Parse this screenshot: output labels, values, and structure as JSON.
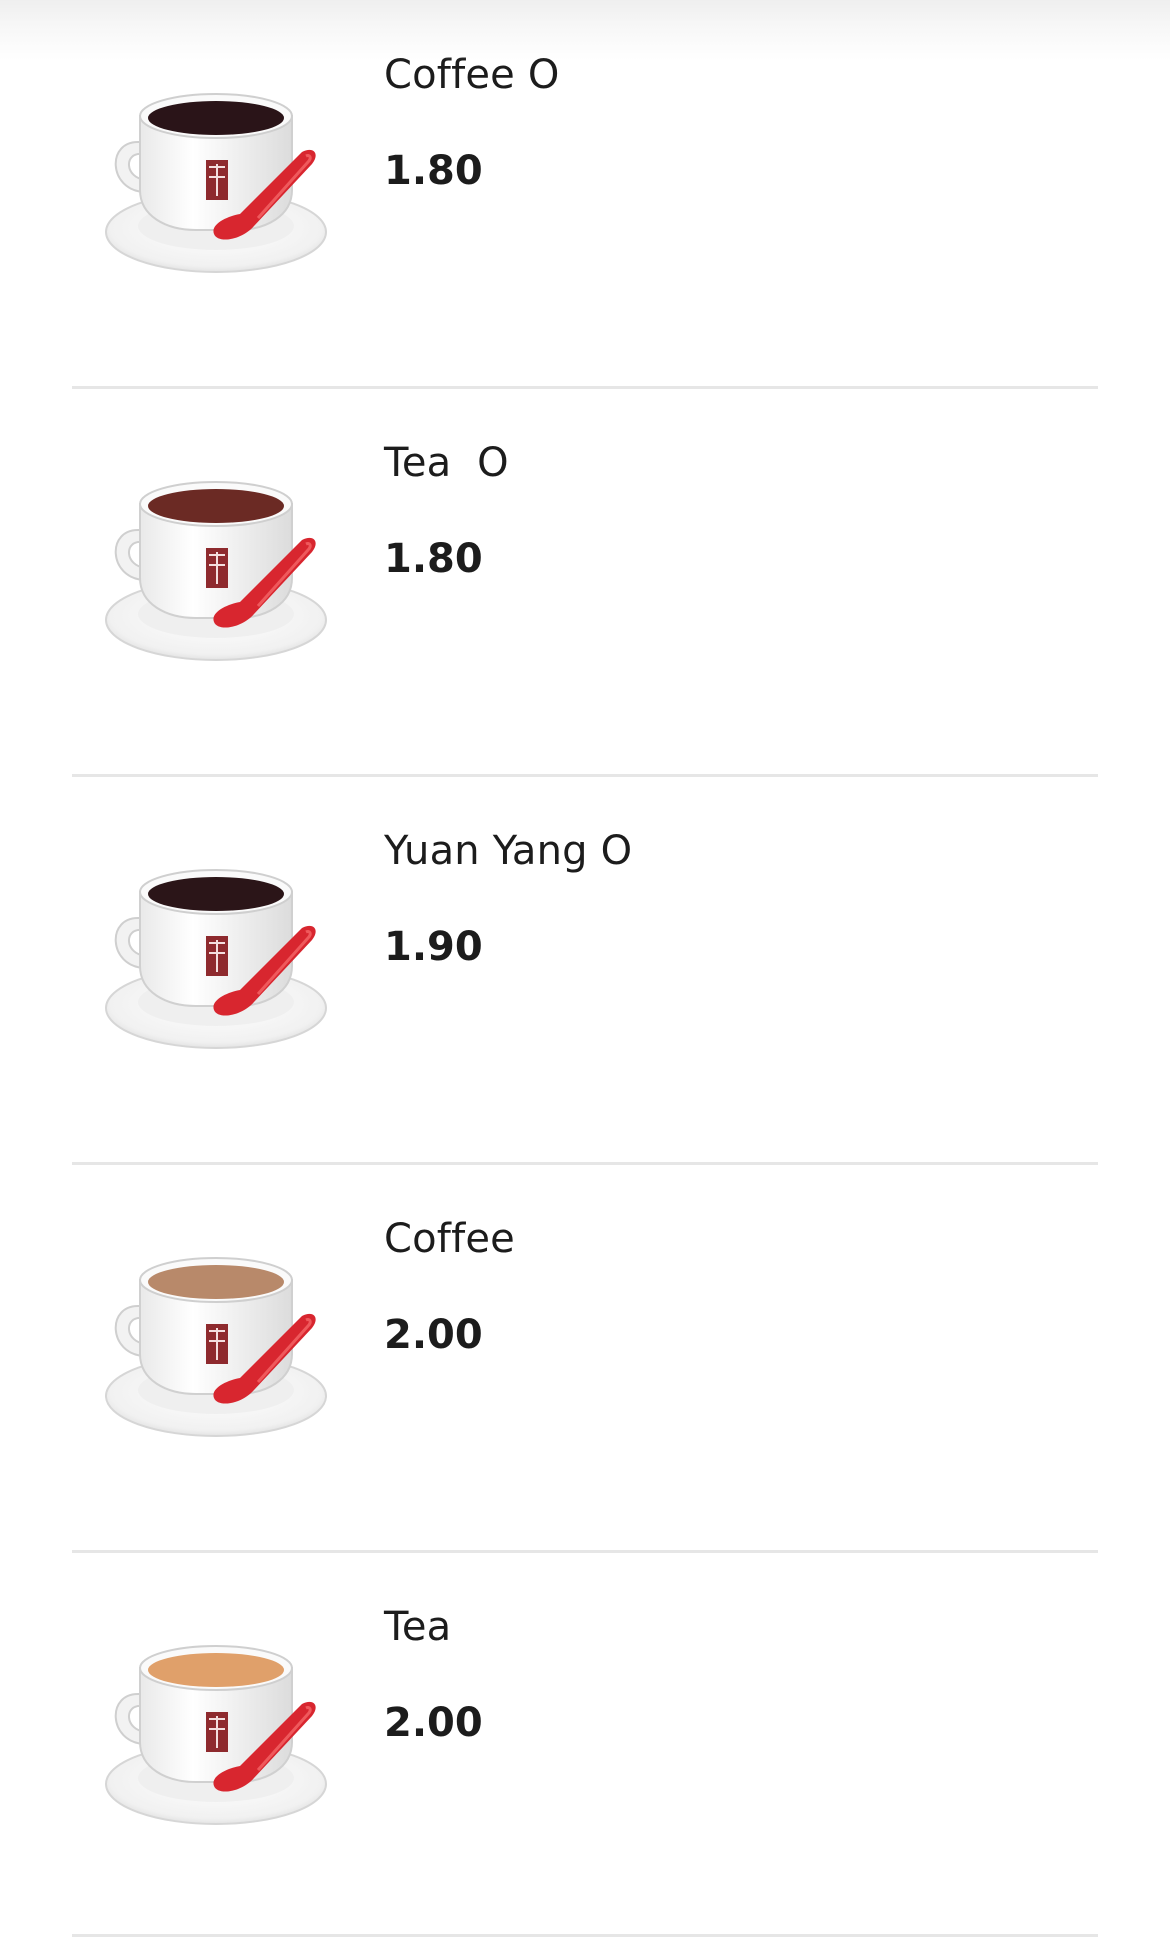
{
  "menu": {
    "items": [
      {
        "name": "Coffee O",
        "price": "1.80",
        "drink_color": "#2a1418",
        "icon": "coffee-cup-icon"
      },
      {
        "name": "Tea  O",
        "price": "1.80",
        "drink_color": "#6b2a24",
        "icon": "tea-cup-icon"
      },
      {
        "name": "Yuan Yang O",
        "price": "1.90",
        "drink_color": "#2b1518",
        "icon": "coffee-cup-icon"
      },
      {
        "name": "Coffee",
        "price": "2.00",
        "drink_color": "#b8896a",
        "icon": "coffee-cup-icon"
      },
      {
        "name": "Tea",
        "price": "2.00",
        "drink_color": "#e0a06a",
        "icon": "tea-cup-icon"
      }
    ]
  },
  "colors": {
    "spoon": "#d8262f",
    "logo": "#8e2a2e",
    "divider": "#e6e6e6"
  }
}
